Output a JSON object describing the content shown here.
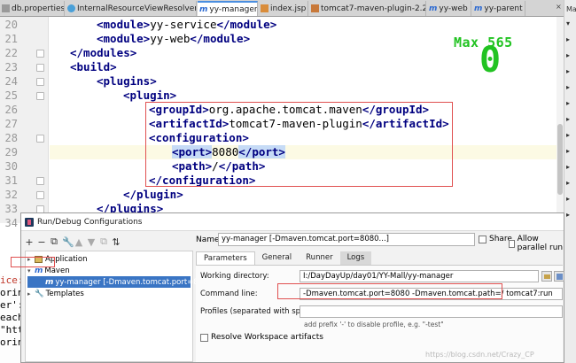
{
  "tabs": [
    {
      "label": "db.properties",
      "active": false
    },
    {
      "label": "InternalResourceViewResolver.java",
      "active": false
    },
    {
      "label": "yy-manager",
      "active": true
    },
    {
      "label": "index.jsp",
      "active": false
    },
    {
      "label": "tomcat7-maven-plugin-2.2.pom",
      "active": false
    },
    {
      "label": "yy-web",
      "active": false
    },
    {
      "label": "yy-parent",
      "active": false
    }
  ],
  "tab_more": "×",
  "line_numbers": [
    "20",
    "21",
    "22",
    "23",
    "24",
    "25",
    "26",
    "27",
    "28",
    "29",
    "30",
    "31",
    "32",
    "33",
    "34",
    "35"
  ],
  "code": {
    "l20": {
      "tag_open": "<module>",
      "text": "yy-service",
      "tag_close": "</module>"
    },
    "l21": {
      "tag_open": "<module>",
      "text": "yy-web",
      "tag_close": "</module>"
    },
    "l22": {
      "tag": "</modules>"
    },
    "l23": {
      "tag": "<build>"
    },
    "l24": {
      "tag": "<plugins>"
    },
    "l25": {
      "tag": "<plugin>"
    },
    "l26": {
      "tag_open": "<groupId>",
      "text": "org.apache.tomcat.maven",
      "tag_close": "</groupId>"
    },
    "l27": {
      "tag_open": "<artifactId>",
      "text": "tomcat7-maven-plugin",
      "tag_close": "</artifactId>"
    },
    "l28": {
      "tag": "<configuration>"
    },
    "l29": {
      "tag_open": "<port>",
      "text": "8080",
      "tag_close": "</port>"
    },
    "l30": {
      "tag_open": "<path>",
      "text": "/",
      "tag_close": "</path>"
    },
    "l31": {
      "tag": "</configuration>"
    },
    "l32": {
      "tag": "</plugin>"
    },
    "l33": {
      "tag": "</plugins>"
    }
  },
  "overlay": {
    "max_label": "Max 565",
    "value": "0"
  },
  "right_strip": [
    "Ma",
    "▾",
    "▸",
    "▸",
    "▸",
    "▸",
    "▸",
    "▸",
    "▸",
    "▸",
    "▸",
    "▸",
    "▸",
    "▸"
  ],
  "left_panel": [
    "ice:",
    "orin",
    "er':",
    "each",
    "\"htt",
    "orin"
  ],
  "dialog": {
    "title": "Run/Debug Configurations",
    "toolbar": [
      "+",
      "−",
      "⧉",
      "🔧",
      "▲",
      "▼",
      "⧉",
      "⇅"
    ],
    "tree": {
      "application": "Application",
      "maven": "Maven",
      "selected_config": "yy-manager [-Dmaven.tomcat.port=8080...]",
      "templates": "Templates"
    },
    "name_label": "Name:",
    "name_value": "yy-manager [-Dmaven.tomcat.port=8080...]",
    "share_label": "Share",
    "parallel_label": "Allow parallel run",
    "panel_tabs": [
      "Parameters",
      "General",
      "Runner",
      "Logs"
    ],
    "working_dir_label": "Working directory:",
    "working_dir_value": "I:/DayDayUp/day01/YY-Mall/yy-manager",
    "command_line_label": "Command line:",
    "command_line_value": "-Dmaven.tomcat.port=8080 -Dmaven.tomcat.path=/ tomcat7:run",
    "profiles_label": "Profiles (separated with space):",
    "profiles_value": "",
    "profiles_hint": "add prefix '-' to disable profile, e.g. \"-test\"",
    "resolve_label": "Resolve Workspace artifacts"
  },
  "watermark": "https://blog.csdn.net/Crazy_CP"
}
